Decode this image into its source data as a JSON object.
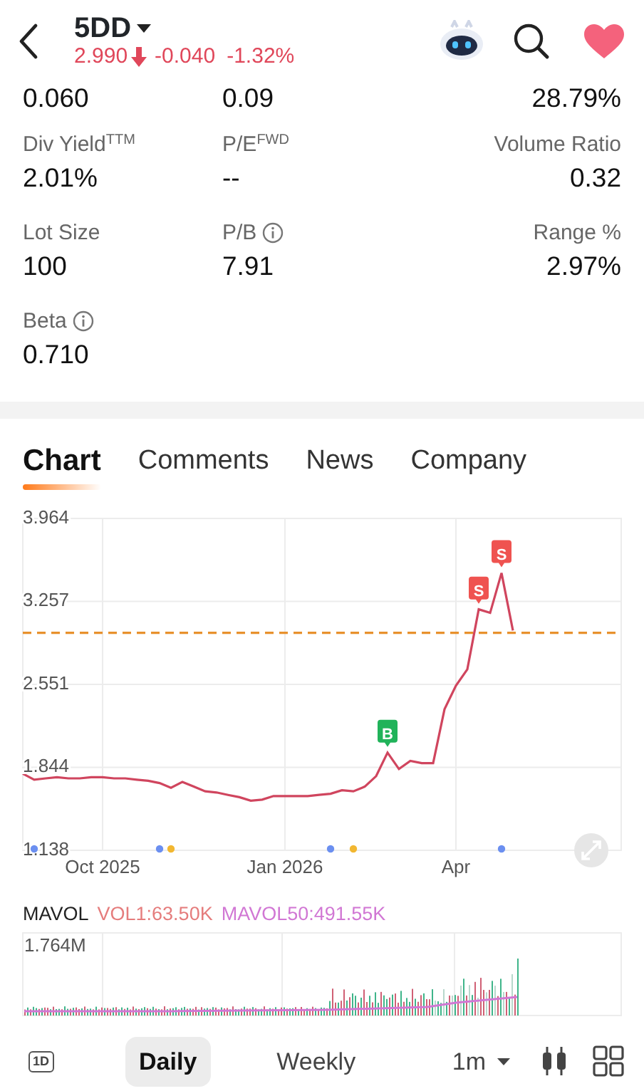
{
  "header": {
    "ticker": "5DD",
    "price": "2.990",
    "change": "-0.040",
    "change_pct": "-1.32%",
    "falling": true,
    "favorited": true
  },
  "stats": [
    [
      {
        "value": "0.060"
      },
      {
        "value": "0.09"
      },
      {
        "value": "28.79%"
      }
    ],
    [
      {
        "label": "Div Yield$^{TTM}$",
        "value": "2.01%",
        "info": false
      },
      {
        "label": "P/E$^{FWD}$",
        "value": "--",
        "info": false
      },
      {
        "label": "Volume Ratio",
        "value": "0.32",
        "info": false
      }
    ],
    [
      {
        "label": "Lot Size",
        "value": "100",
        "info": false
      },
      {
        "label": "P/B",
        "value": "7.91",
        "info": true
      },
      {
        "label": "Range %",
        "value": "2.97%",
        "info": false
      }
    ],
    [
      {
        "label": "Beta",
        "value": "0.710",
        "info": true
      }
    ]
  ],
  "tabs": [
    {
      "label": "Chart",
      "selected": true
    },
    {
      "label": "Comments",
      "selected": false
    },
    {
      "label": "News",
      "selected": false
    },
    {
      "label": "Company",
      "selected": false
    }
  ],
  "chart": {
    "chart_data": {
      "type": "line",
      "ylim": [
        1.138,
        3.964
      ],
      "categories": [
        null,
        null,
        null,
        null,
        null,
        null,
        null,
        "Oct 2025",
        null,
        null,
        null,
        null,
        null,
        null,
        null,
        null,
        null,
        null,
        null,
        null,
        null,
        null,
        null,
        "Jan 2026",
        null,
        null,
        null,
        null,
        null,
        null,
        null,
        null,
        null,
        null,
        null,
        null,
        null,
        null,
        "Apr",
        null,
        null,
        null,
        null,
        null
      ],
      "yticks": [
        {
          "value": 1.138,
          "label": "1.138"
        },
        {
          "value": 1.844,
          "label": "1.844"
        },
        {
          "value": 2.551,
          "label": "2.551"
        },
        {
          "value": 3.257,
          "label": "3.257"
        },
        {
          "value": 3.964,
          "label": "3.964"
        }
      ],
      "series": [
        {
          "color": "#d0455e",
          "values": [
            1.79,
            1.74,
            1.75,
            1.76,
            1.75,
            1.75,
            1.76,
            1.76,
            1.75,
            1.75,
            1.74,
            1.73,
            1.71,
            1.67,
            1.72,
            1.68,
            1.64,
            1.63,
            1.61,
            1.59,
            1.56,
            1.57,
            1.6,
            1.6,
            1.6,
            1.6,
            1.61,
            1.62,
            1.65,
            1.64,
            1.68,
            1.77,
            1.97,
            1.83,
            1.9,
            1.88,
            1.88,
            2.34,
            2.54,
            2.68,
            3.19,
            3.16,
            3.5,
            3.01
          ]
        }
      ],
      "grid": true
    },
    "trade_marks": [
      {
        "kind": "buy",
        "text": "B"
      },
      {
        "kind": "sell",
        "text": "S"
      },
      {
        "kind": "sell",
        "text": "S"
      }
    ]
  },
  "volume": {
    "legend": [
      {
        "kind": "name",
        "text": "MAVOL"
      },
      {
        "kind": "vol",
        "text": "VOL1:63.50K"
      },
      {
        "kind": "ma",
        "text": "MAVOL50:491.55K"
      }
    ],
    "axis_label": "1.764M"
  },
  "toolbar": {
    "period_icon_text": "1D",
    "periods": [
      {
        "label": "Daily",
        "selected": true
      },
      {
        "label": "Weekly",
        "selected": false
      }
    ],
    "interval": "1m"
  }
}
